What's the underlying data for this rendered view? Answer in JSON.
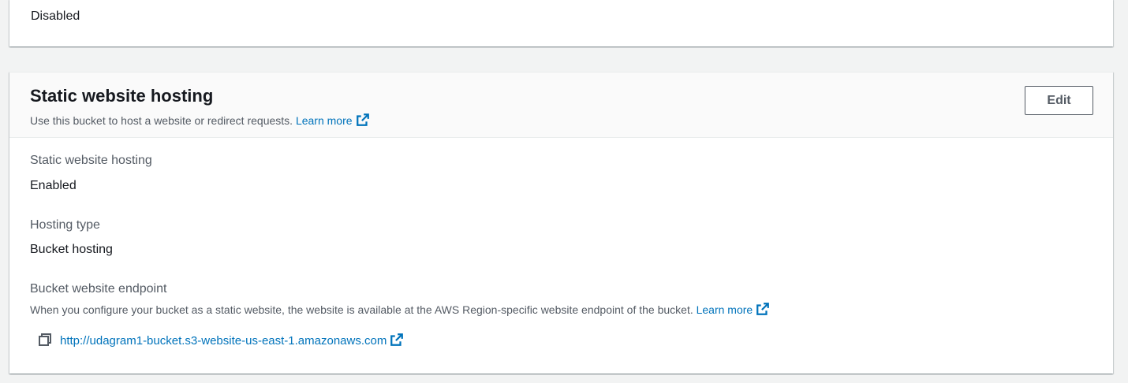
{
  "previous_panel": {
    "value": "Disabled"
  },
  "static_hosting_panel": {
    "title": "Static website hosting",
    "description": "Use this bucket to host a website or redirect requests.",
    "learn_more": "Learn more",
    "edit_label": "Edit",
    "fields": {
      "hosting": {
        "label": "Static website hosting",
        "value": "Enabled"
      },
      "hosting_type": {
        "label": "Hosting type",
        "value": "Bucket hosting"
      },
      "endpoint": {
        "label": "Bucket website endpoint",
        "description": "When you configure your bucket as a static website, the website is available at the AWS Region-specific website endpoint of the bucket.",
        "learn_more": "Learn more",
        "url": "http://udagram1-bucket.s3-website-us-east-1.amazonaws.com"
      }
    }
  },
  "icons": {
    "external_link": "external-link-icon",
    "copy": "copy-icon"
  },
  "colors": {
    "link": "#0073bb",
    "background": "#f2f3f3",
    "header_background": "#fafafa",
    "label": "#545b64",
    "text": "#16191f"
  }
}
